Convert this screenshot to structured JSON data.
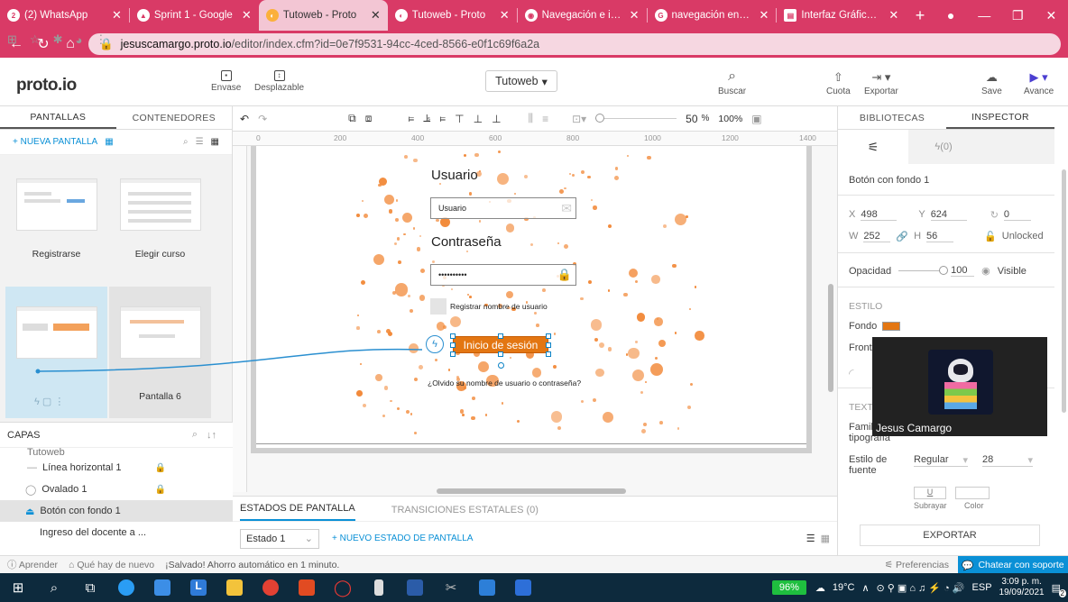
{
  "browser": {
    "tabs": [
      {
        "icon": "whatsapp-icon",
        "title": "(2) WhatsApp",
        "badge": "2"
      },
      {
        "icon": "google-drive-icon",
        "title": "Sprint 1 - Google"
      },
      {
        "icon": "protoio-icon",
        "title": "Tutoweb - Proto",
        "active": true
      },
      {
        "icon": "protoio-icon",
        "title": "Tutoweb - Proto"
      },
      {
        "icon": "globe-icon",
        "title": "Navegación e inte"
      },
      {
        "icon": "google-icon",
        "title": "navegación entre"
      },
      {
        "icon": "doc-icon",
        "title": "Interfaz Gráfica d"
      }
    ],
    "url_host": "jesuscamargo.proto.io",
    "url_path": "/editor/index.cfm?id=0e7f9531-94cc-4ced-8566-e0f1c69f6a2a"
  },
  "app": {
    "logo": "proto.io",
    "header_buttons": {
      "envase": "Envase",
      "desplazable": "Desplazable",
      "buscar": "Buscar",
      "cuota": "Cuota",
      "exportar": "Exportar",
      "save": "Save",
      "avance": "Avance"
    },
    "page_select": "Tutoweb"
  },
  "left": {
    "tab_pantallas": "PANTALLAS",
    "tab_contenedores": "CONTENEDORES",
    "new_screen": "+ NUEVA PANTALLA",
    "screens": [
      "Registrarse",
      "Elegir curso",
      "",
      "Pantalla 6"
    ],
    "layers_title": "CAPAS",
    "layers": [
      {
        "name": "Tutoweb"
      },
      {
        "name": "Línea horizontal 1"
      },
      {
        "name": "Ovalado 1"
      },
      {
        "name": "Botón con fondo 1",
        "selected": true
      },
      {
        "name": "Ingreso del docente a ..."
      }
    ]
  },
  "canvas": {
    "ruler_ticks": [
      "0",
      "200",
      "400",
      "600",
      "800",
      "1000",
      "1200",
      "1400"
    ],
    "zoom": "50",
    "zoom_unit": "%",
    "zoom_100": "100%",
    "login": {
      "user_label": "Usuario",
      "user_value": "Usuario",
      "pass_label": "Contraseña",
      "pass_value": "••••••••••",
      "remember": "Registrar nombre de usuario",
      "button": "Inicio de sesión",
      "forgot": "¿Olvido su nombre de usuario o contraseña?"
    },
    "state_tabs": [
      "ESTADOS DE PANTALLA",
      "TRANSICIONES ESTATALES (0)"
    ],
    "state_select": "Estado 1",
    "new_state": "+ NUEVO ESTADO DE PANTALLA"
  },
  "inspector": {
    "tab_libs": "BIBLIOTECAS",
    "tab_inspector": "INSPECTOR",
    "interactions": "(0)",
    "element_name": "Botón con fondo 1",
    "x_label": "X",
    "x": "498",
    "y_label": "Y",
    "y": "624",
    "rot": "0",
    "w_label": "W",
    "w": "252",
    "h_label": "H",
    "h": "56",
    "unlocked": "Unlocked",
    "opacity_label": "Opacidad",
    "opacity": "100",
    "visible": "Visible",
    "style": "ESTILO",
    "fondo": "Fondo",
    "frontera": "Fronte",
    "text_section": "TEXTO",
    "familia": "Famil",
    "tipografia": "tipografía",
    "estilo_fuente": "Estilo de fuente",
    "estilo_val": "Regular",
    "size": "28",
    "subrayar": "Subrayar",
    "color": "Color",
    "export": "EXPORTAR",
    "accent": "#e37612"
  },
  "video": {
    "name": "Jesus Camargo"
  },
  "status": {
    "learn": "Aprender",
    "news": "Qué hay de nuevo",
    "saved": "¡Salvado! Ahorro automático en 1 minuto.",
    "prefs": "Preferencias",
    "support": "Chatear con soporte"
  },
  "taskbar": {
    "battery": "96%",
    "temp": "19°C",
    "lang": "ESP",
    "time": "3:09 p. m.",
    "date": "19/09/2021",
    "notif": "2"
  }
}
